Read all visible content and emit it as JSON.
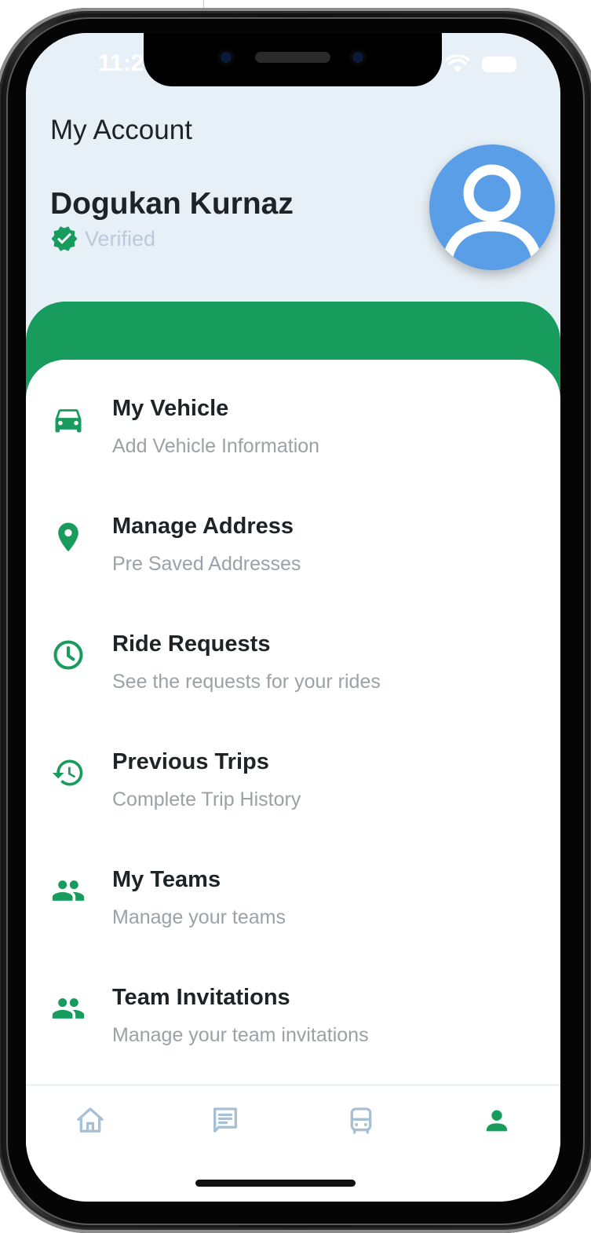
{
  "status_bar": {
    "time": "11:2"
  },
  "header": {
    "title": "My Account",
    "user_name": "Dogukan Kurnaz",
    "verified_label": "Verified"
  },
  "menu": [
    {
      "icon": "car-icon",
      "title": "My Vehicle",
      "subtitle": "Add Vehicle Information"
    },
    {
      "icon": "location-pin-icon",
      "title": "Manage Address",
      "subtitle": "Pre Saved Addresses"
    },
    {
      "icon": "clock-icon",
      "title": "Ride Requests",
      "subtitle": "See the requests for your rides"
    },
    {
      "icon": "history-icon",
      "title": "Previous Trips",
      "subtitle": "Complete Trip History"
    },
    {
      "icon": "people-icon",
      "title": "My Teams",
      "subtitle": "Manage your teams"
    },
    {
      "icon": "people-icon",
      "title": "Team Invitations",
      "subtitle": "Manage your team invitations"
    }
  ],
  "bottom_nav": [
    {
      "icon": "home-icon",
      "active": false
    },
    {
      "icon": "chat-icon",
      "active": false
    },
    {
      "icon": "bus-icon",
      "active": false
    },
    {
      "icon": "profile-icon",
      "active": true
    }
  ],
  "colors": {
    "accent_green": "#189c5e",
    "header_bg": "#e8f0f7",
    "avatar_blue": "#5a9ee8",
    "inactive_nav": "#a8c0d6"
  }
}
